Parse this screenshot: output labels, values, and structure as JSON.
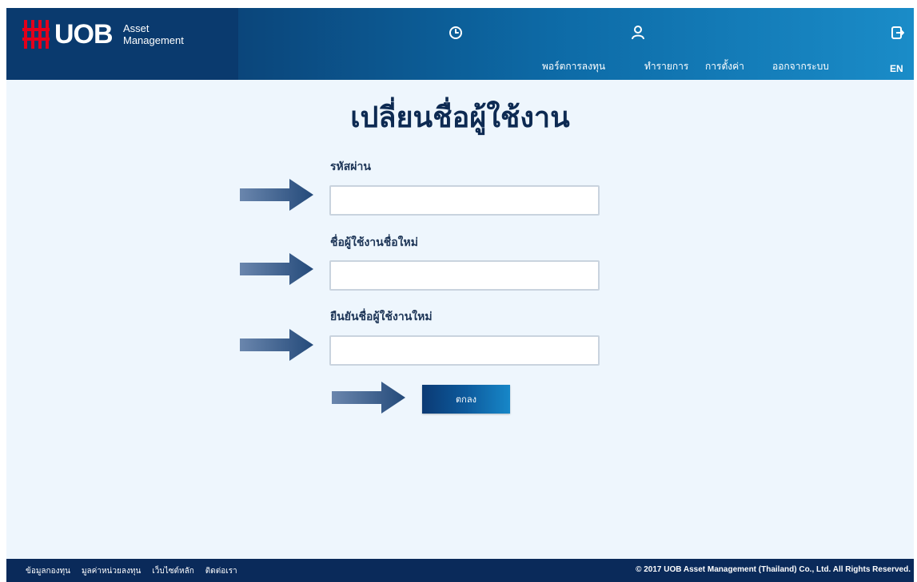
{
  "brand": {
    "name": "UOB",
    "sub_line1": "Asset",
    "sub_line2": "Management",
    "logo_color": "#e3001b"
  },
  "header": {
    "icons": [
      "clock-icon",
      "user-icon",
      "logout-icon"
    ],
    "nav": {
      "portfolio": "พอร์ตการลงทุน",
      "transaction": "ทำรายการ",
      "settings": "การตั้งค่า",
      "logout": "ออกจากระบบ",
      "language": "EN"
    }
  },
  "page": {
    "title": "เปลี่ยนชื่อผู้ใช้งาน",
    "fields": [
      {
        "label": "รหัสผ่าน",
        "value": "",
        "placeholder": ""
      },
      {
        "label": "ชื่อผู้ใช้งานชื่อใหม่",
        "value": "",
        "placeholder": ""
      },
      {
        "label": "ยืนยันชื่อผู้ใช้งานใหม่",
        "value": "",
        "placeholder": ""
      }
    ],
    "submit_label": "ตกลง"
  },
  "footer": {
    "links": [
      "ข้อมูลกองทุน",
      "มูลค่าหน่วยลงทุน",
      "เว็บไซต์หลัก",
      "ติดต่อเรา"
    ],
    "copyright": "© 2017 UOB Asset Management (Thailand) Co., Ltd. All Rights Reserved."
  },
  "colors": {
    "header_dark": "#0a2e5e",
    "header_light": "#1a8cc8",
    "page_bg": "#eef6fd",
    "title": "#0d2a52",
    "footer_bg": "#0a2a5a"
  }
}
